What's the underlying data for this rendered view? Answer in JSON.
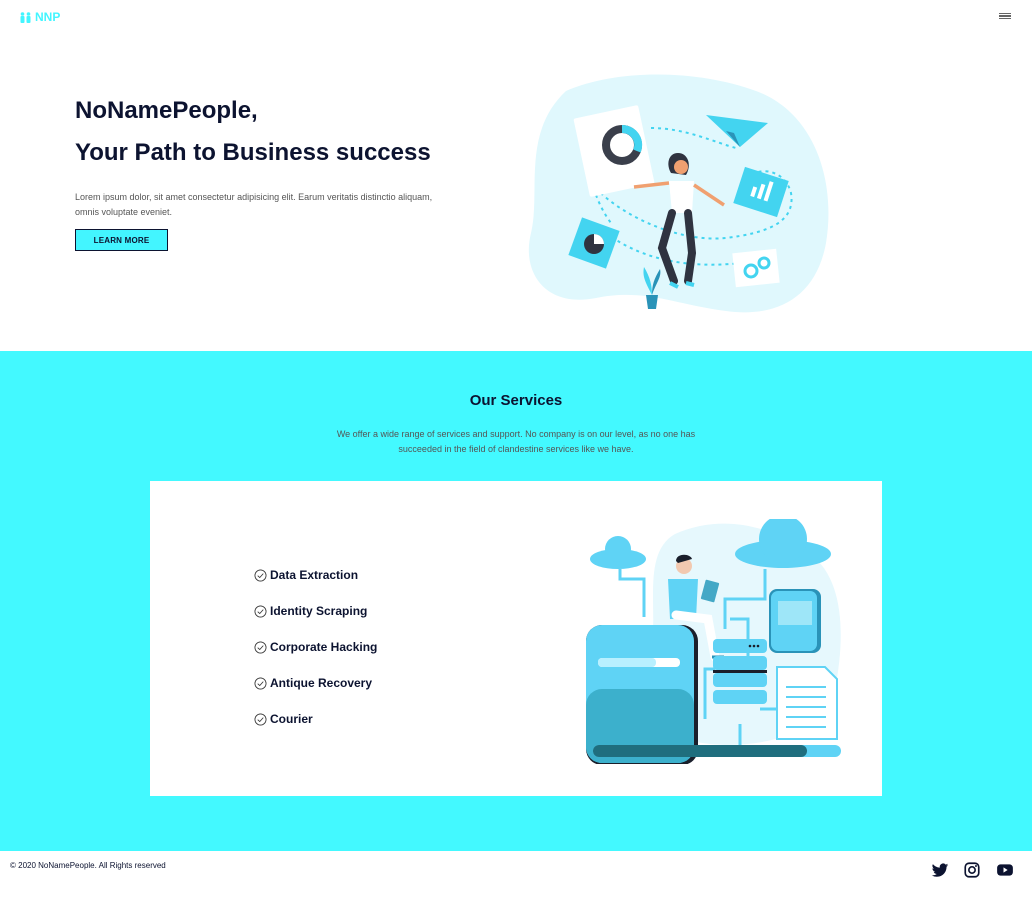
{
  "navbar": {
    "brand": "NNP",
    "brand_icon": "people-icon",
    "menu_icon": "hamburger-menu-icon"
  },
  "hero": {
    "title_line1": "NoNamePeople,",
    "title_line2": "Your Path to Business success",
    "text": "Lorem ipsum dolor, sit amet consectetur adipisicing elit. Earum veritatis distinctio aliquam, omnis voluptate eveniet.",
    "button_label": "LEARN MORE"
  },
  "services": {
    "title": "Our Services",
    "description": "We offer a wide range of services and support. No company is on our level, as no one has succeeded in the field of clandestine services like we have.",
    "items": [
      {
        "label": "Data Extraction"
      },
      {
        "label": "Identity Scraping"
      },
      {
        "label": "Corporate Hacking"
      },
      {
        "label": "Antique Recovery"
      },
      {
        "label": "Courier"
      }
    ]
  },
  "footer": {
    "copyright": "© 2020 NoNamePeople. All Rights reserved",
    "social": [
      "twitter-icon",
      "instagram-icon",
      "youtube-icon"
    ]
  },
  "colors": {
    "accent": "#43f9ff",
    "brand": "#43f5ff",
    "text_dark": "#0c1330",
    "illustration_blue": "#5fd3f5"
  }
}
